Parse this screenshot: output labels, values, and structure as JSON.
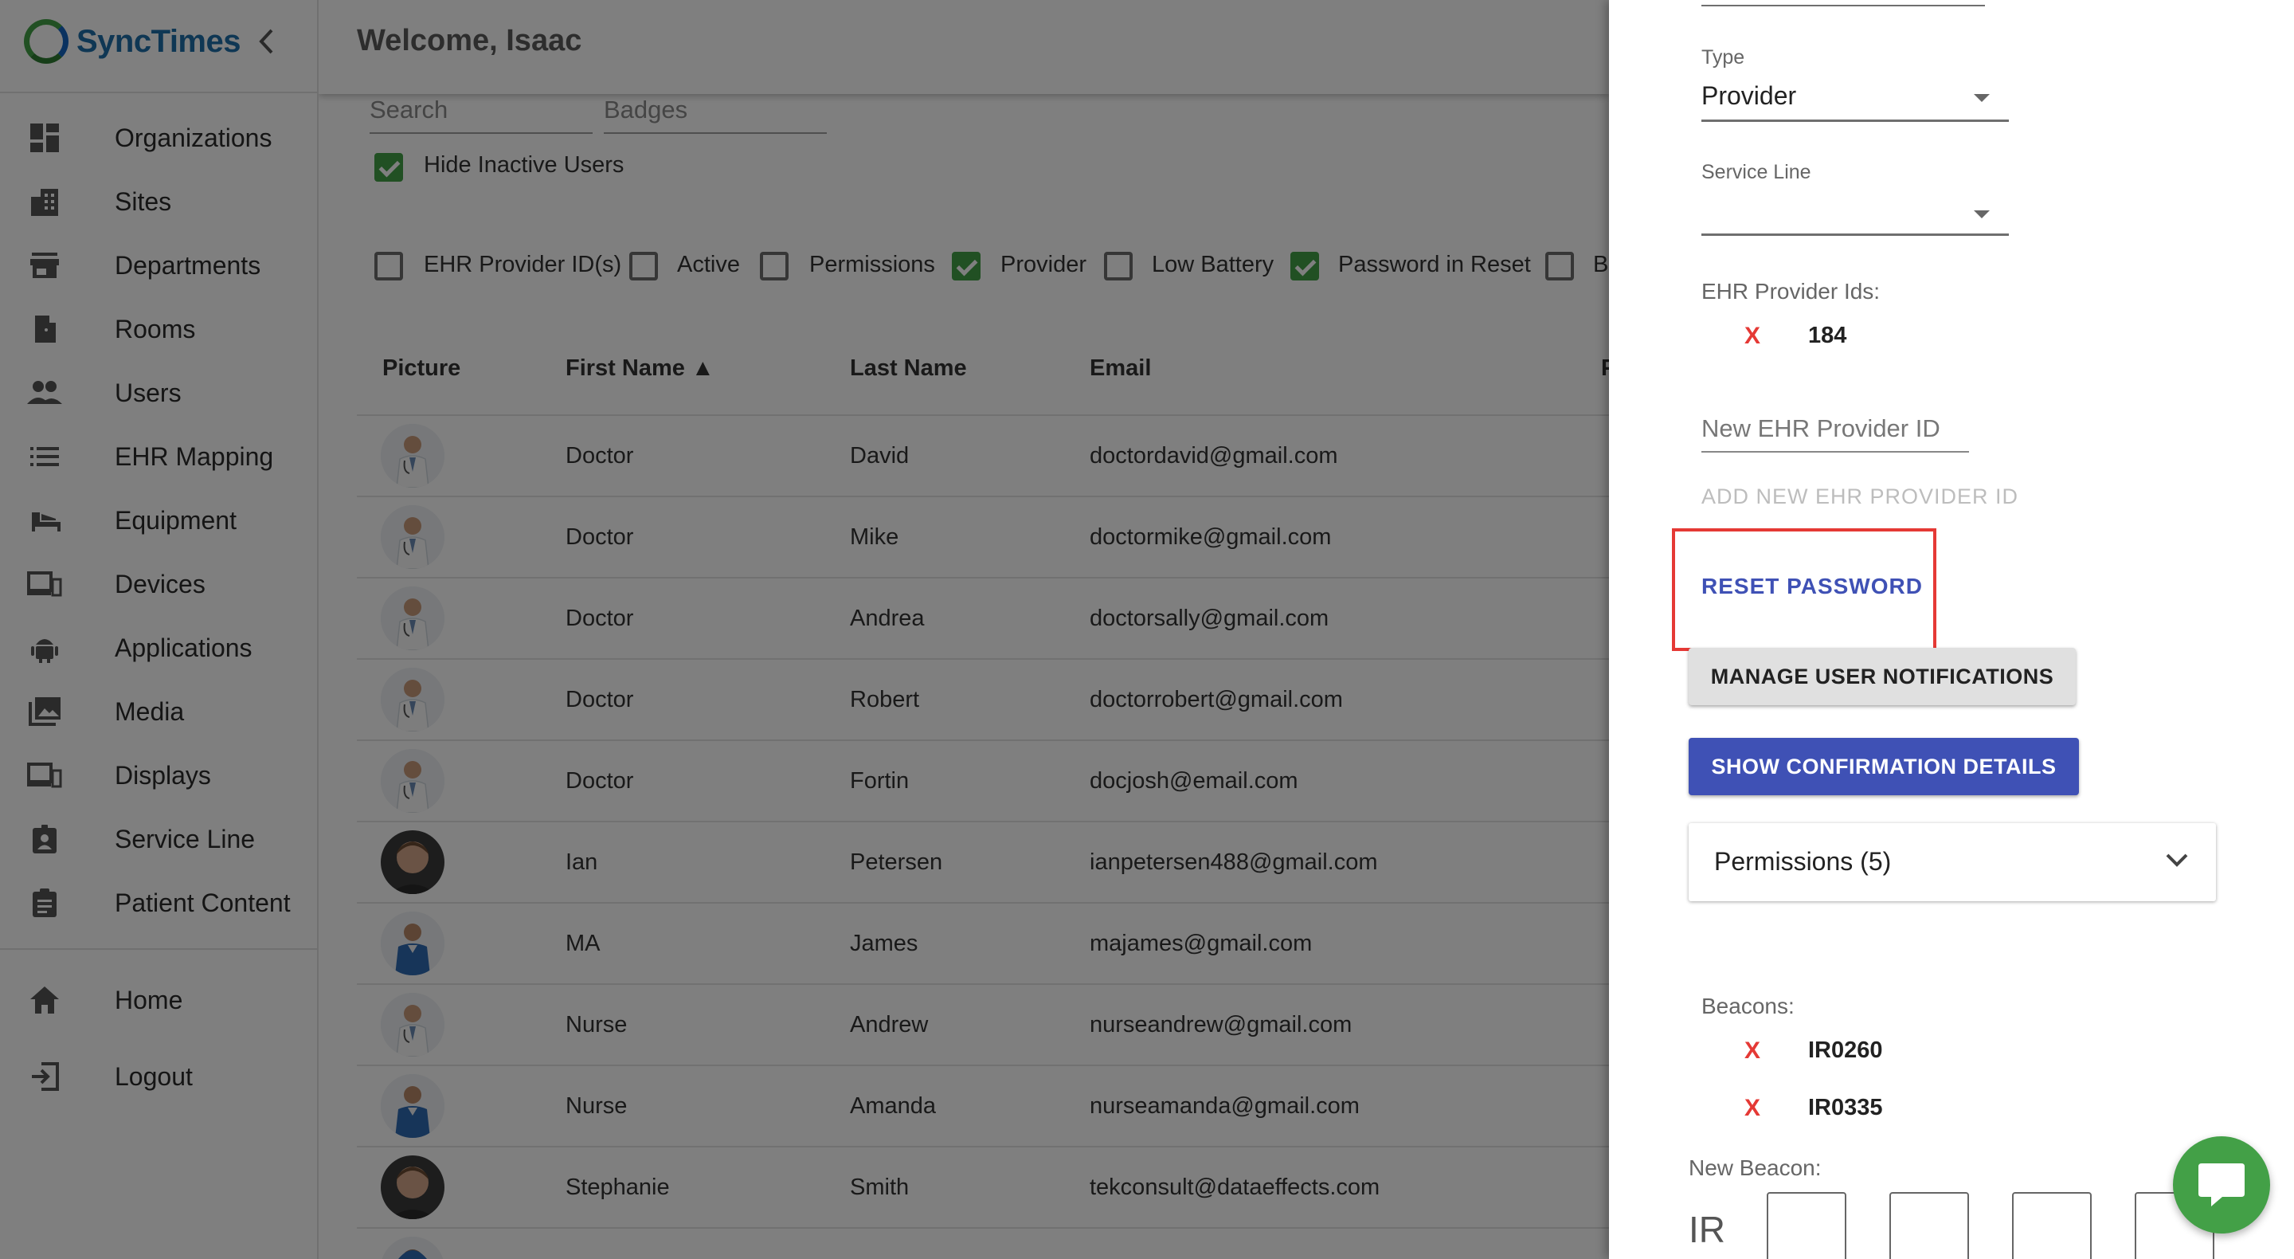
{
  "brand": {
    "name": "SyncTimes"
  },
  "sidebar": {
    "items": [
      {
        "label": "Organizations",
        "icon": "dashboard-icon"
      },
      {
        "label": "Sites",
        "icon": "building-icon"
      },
      {
        "label": "Departments",
        "icon": "store-icon"
      },
      {
        "label": "Rooms",
        "icon": "door-icon"
      },
      {
        "label": "Users",
        "icon": "people-icon"
      },
      {
        "label": "EHR Mapping",
        "icon": "list-icon"
      },
      {
        "label": "Equipment",
        "icon": "bed-icon"
      },
      {
        "label": "Devices",
        "icon": "devices-icon"
      },
      {
        "label": "Applications",
        "icon": "android-icon"
      },
      {
        "label": "Media",
        "icon": "photo-library-icon"
      },
      {
        "label": "Displays",
        "icon": "devices-icon"
      },
      {
        "label": "Service Line",
        "icon": "badge-icon"
      },
      {
        "label": "Patient Content",
        "icon": "clipboard-icon"
      }
    ],
    "bottom_items": [
      {
        "label": "Home",
        "icon": "home-icon"
      },
      {
        "label": "Logout",
        "icon": "logout-icon"
      }
    ]
  },
  "header": {
    "welcome": "Welcome, Isaac"
  },
  "filters": {
    "search_placeholder": "Search",
    "badges_placeholder": "Badges",
    "hide_inactive": {
      "label": "Hide Inactive Users",
      "checked": true
    }
  },
  "columns_toggle": [
    {
      "label": "EHR Provider ID(s)",
      "checked": false
    },
    {
      "label": "Active",
      "checked": false
    },
    {
      "label": "Permissions",
      "checked": false
    },
    {
      "label": "Provider",
      "checked": true
    },
    {
      "label": "Low Battery",
      "checked": false
    },
    {
      "label": "Password in Reset",
      "checked": true
    },
    {
      "label": "B",
      "checked": false
    }
  ],
  "table": {
    "headers": {
      "picture": "Picture",
      "first_name": "First Name ▲",
      "last_name": "Last Name",
      "email": "Email",
      "partial": "P"
    },
    "rows": [
      {
        "first": "Doctor",
        "last": "David",
        "email": "doctordavid@gmail.com",
        "avatar": "doctor"
      },
      {
        "first": "Doctor",
        "last": "Mike",
        "email": "doctormike@gmail.com",
        "avatar": "doctor"
      },
      {
        "first": "Doctor",
        "last": "Andrea",
        "email": "doctorsally@gmail.com",
        "avatar": "doctor"
      },
      {
        "first": "Doctor",
        "last": "Robert",
        "email": "doctorrobert@gmail.com",
        "avatar": "doctor"
      },
      {
        "first": "Doctor",
        "last": "Fortin",
        "email": "docjosh@email.com",
        "avatar": "doctor"
      },
      {
        "first": "Ian",
        "last": "Petersen",
        "email": "ianpetersen488@gmail.com",
        "avatar": "photo"
      },
      {
        "first": "MA",
        "last": "James",
        "email": "majames@gmail.com",
        "avatar": "scrubs"
      },
      {
        "first": "Nurse",
        "last": "Andrew",
        "email": "nurseandrew@gmail.com",
        "avatar": "doctor"
      },
      {
        "first": "Nurse",
        "last": "Amanda",
        "email": "nurseamanda@gmail.com",
        "avatar": "scrubs"
      },
      {
        "first": "Stephanie",
        "last": "Smith",
        "email": "tekconsult@dataeffects.com",
        "avatar": "photo"
      }
    ]
  },
  "drawer": {
    "type": {
      "label": "Type",
      "value": "Provider"
    },
    "service_line": {
      "label": "Service Line",
      "value": ""
    },
    "ehr": {
      "label": "EHR Provider Ids:",
      "ids": [
        "184"
      ],
      "remove_glyph": "X",
      "new_placeholder": "New EHR Provider ID",
      "add_label": "ADD NEW EHR PROVIDER ID"
    },
    "reset_password_label": "RESET PASSWORD",
    "manage_notifications_label": "MANAGE USER NOTIFICATIONS",
    "show_confirmation_label": "SHOW CONFIRMATION DETAILS",
    "permissions_label": "Permissions (5)",
    "beacons": {
      "label": "Beacons:",
      "items": [
        "IR0260",
        "IR0335"
      ],
      "new_label": "New Beacon:",
      "prefix": "IR"
    }
  },
  "colors": {
    "accent_green": "#43a047",
    "primary_indigo": "#3f51b5",
    "danger_red": "#e53935",
    "brand_blue": "#1f6fa8"
  }
}
